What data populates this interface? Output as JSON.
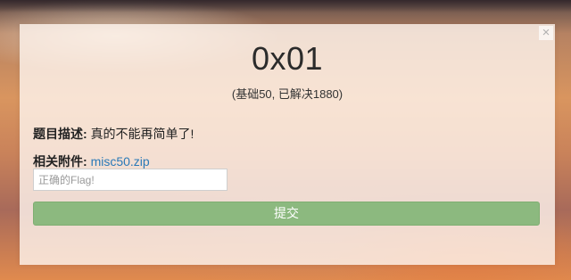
{
  "challenge": {
    "title": "0x01",
    "subtitle": "(基础50, 已解决1880)",
    "description_label": "题目描述:",
    "description_text": "真的不能再简单了!",
    "attachment_label": "相关附件:",
    "attachment_link": "misc50.zip"
  },
  "form": {
    "flag_placeholder": "正确的Flag!",
    "flag_value": "",
    "submit_label": "提交"
  },
  "close": {
    "icon": "close-icon",
    "glyph": "×"
  },
  "colors": {
    "submit": "#8cb97f",
    "link": "#2a7ab8"
  }
}
